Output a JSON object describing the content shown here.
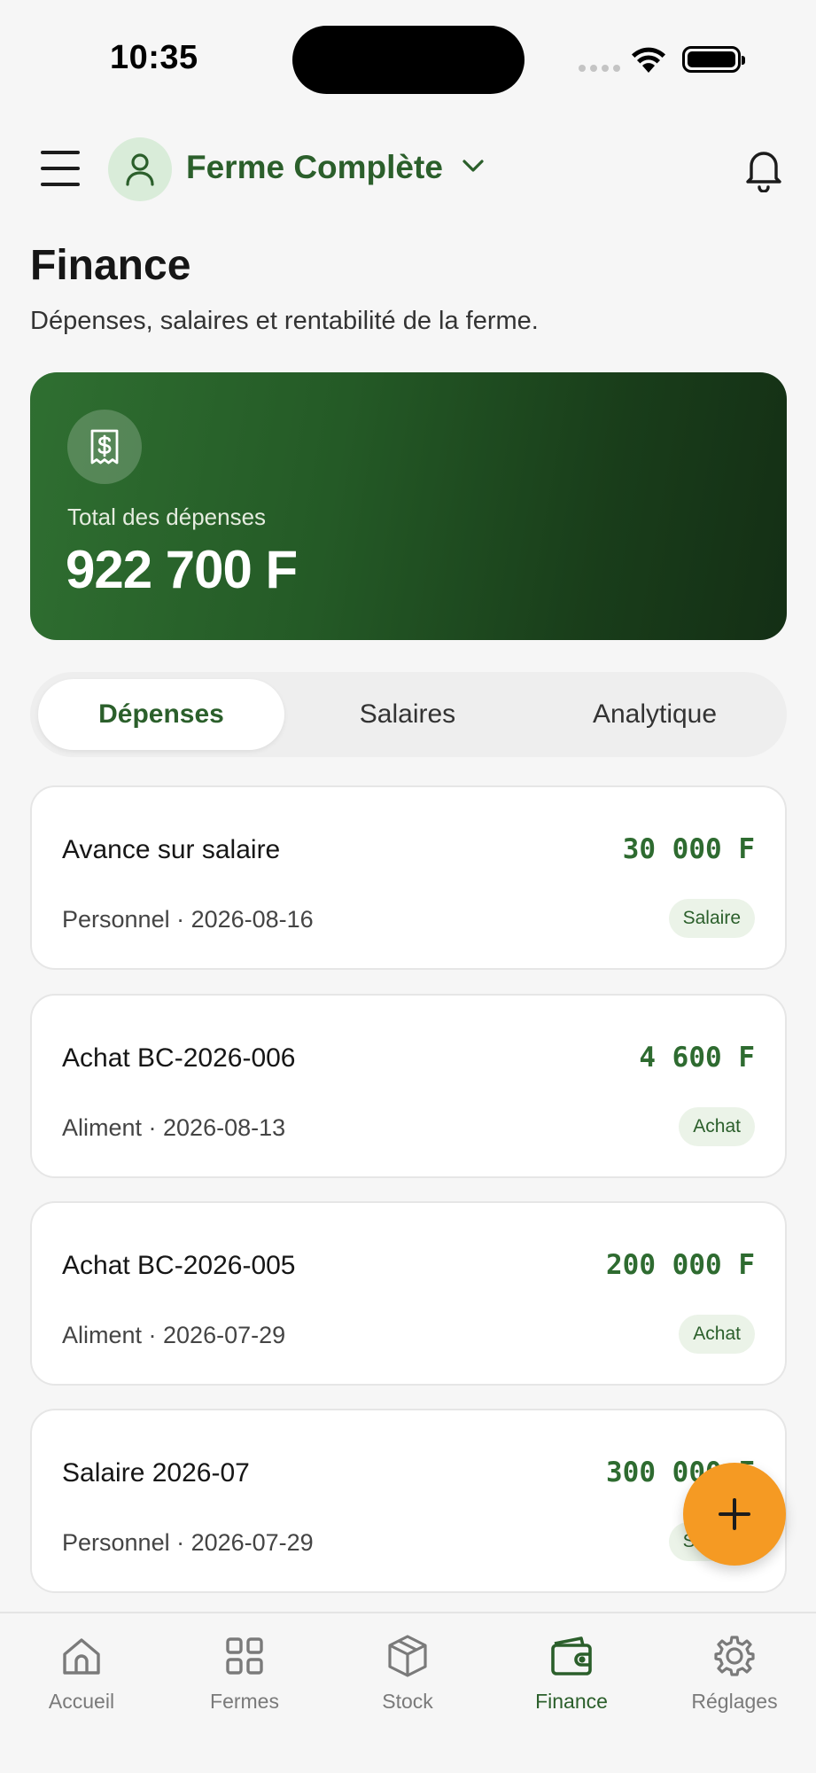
{
  "status_bar": {
    "time": "10:35"
  },
  "header": {
    "farm_name": "Ferme Complète"
  },
  "page": {
    "title": "Finance",
    "subtitle": "Dépenses, salaires et rentabilité de la ferme."
  },
  "summary": {
    "label": "Total des dépenses",
    "amount": "922 700 F"
  },
  "tabs": [
    {
      "label": "Dépenses",
      "active": true
    },
    {
      "label": "Salaires",
      "active": false
    },
    {
      "label": "Analytique",
      "active": false
    }
  ],
  "expenses": [
    {
      "title": "Avance sur salaire",
      "amount": "30 000 F",
      "meta": "Personnel · 2026-08-16",
      "badge": "Salaire"
    },
    {
      "title": "Achat BC-2026-006",
      "amount": "4 600 F",
      "meta": "Aliment · 2026-08-13",
      "badge": "Achat"
    },
    {
      "title": "Achat BC-2026-005",
      "amount": "200 000 F",
      "meta": "Aliment · 2026-07-29",
      "badge": "Achat"
    },
    {
      "title": "Salaire 2026-07",
      "amount": "300 000 F",
      "meta": "Personnel · 2026-07-29",
      "badge": "Salaire"
    }
  ],
  "bottom_nav": [
    {
      "label": "Accueil",
      "icon": "home-icon",
      "active": false
    },
    {
      "label": "Fermes",
      "icon": "grid-icon",
      "active": false
    },
    {
      "label": "Stock",
      "icon": "box-icon",
      "active": false
    },
    {
      "label": "Finance",
      "icon": "wallet-icon",
      "active": true
    },
    {
      "label": "Réglages",
      "icon": "gear-icon",
      "active": false
    }
  ],
  "colors": {
    "brand_green": "#2b5f2b",
    "amount_green": "#2e6b30",
    "fab_orange": "#f59a23",
    "background": "#f6f6f6"
  }
}
